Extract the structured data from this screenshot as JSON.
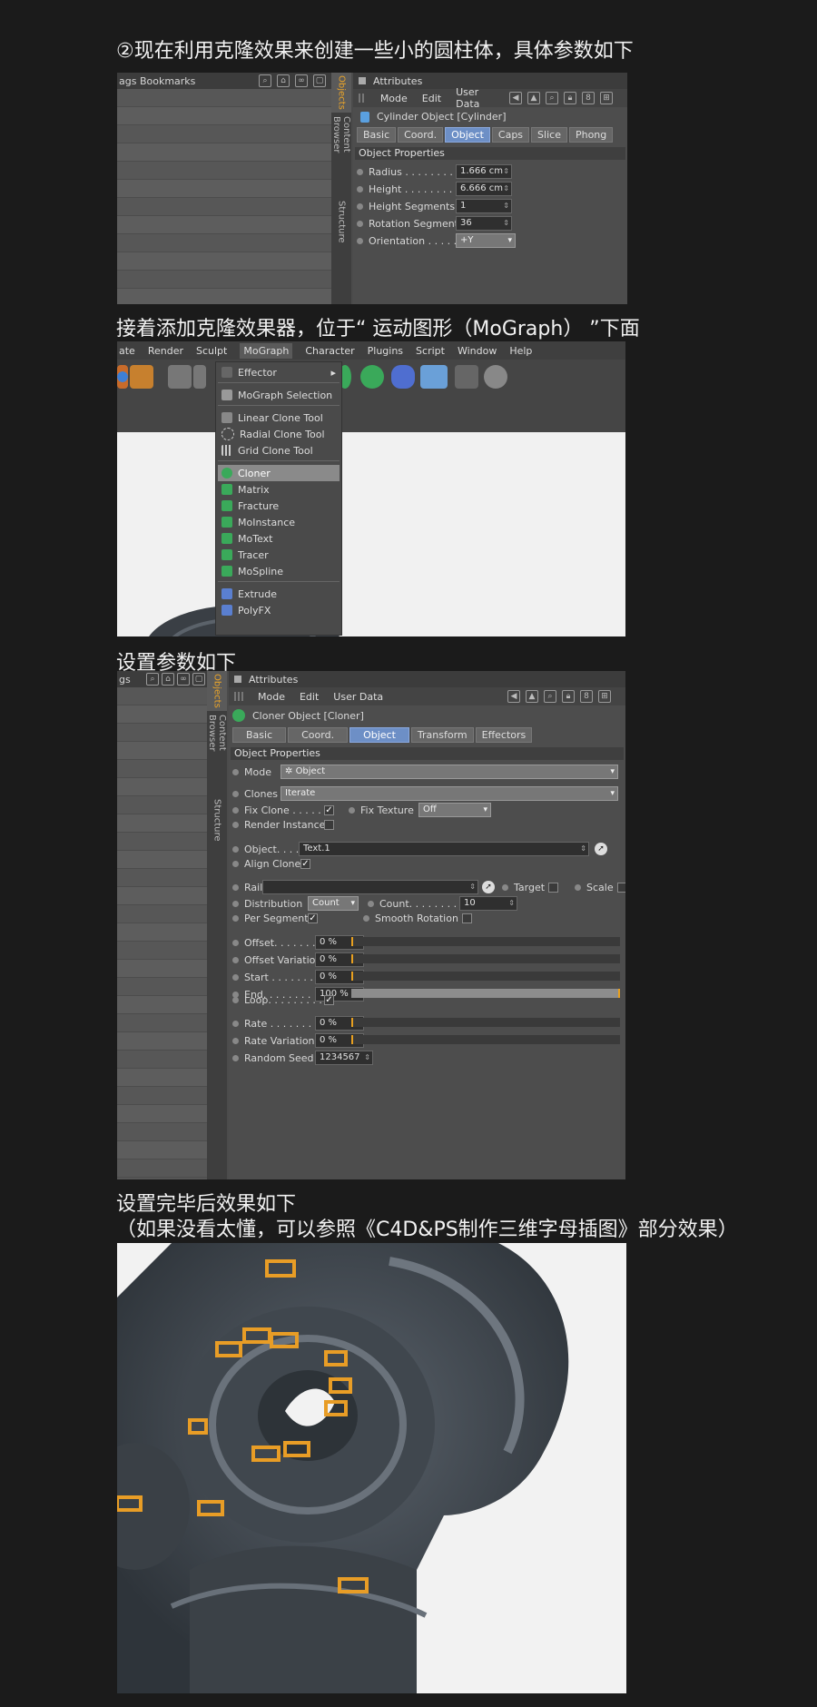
{
  "captions": {
    "c1": "②现在利用克隆效果来创建一些小的圆柱体，具体参数如下",
    "c2": "接着添加克隆效果器，位于“ 运动图形（MoGraph） ”下面",
    "c3": "设置参数如下",
    "c4": "设置完毕后效果如下",
    "c5": "（如果没看太懂，可以参照《C4D&PS制作三维字母插图》部分效果）"
  },
  "panel1": {
    "left_header": "ags   Bookmarks",
    "vtabs": [
      "Objects",
      "Content Browser",
      "Structure"
    ],
    "attr_title": "Attributes",
    "menu": [
      "Mode",
      "Edit",
      "User Data"
    ],
    "object_name": "Cylinder Object [Cylinder]",
    "tabs": [
      "Basic",
      "Coord.",
      "Object",
      "Caps",
      "Slice",
      "Phong"
    ],
    "section": "Object Properties",
    "props": [
      {
        "label": "Radius . . . . . . . . . .",
        "value": "1.666 cm"
      },
      {
        "label": "Height . . . . . . . . . .",
        "value": "6.666 cm"
      },
      {
        "label": "Height Segments",
        "value": "1"
      },
      {
        "label": "Rotation Segments",
        "value": "36"
      },
      {
        "label": "Orientation . . . . . .",
        "value": "+Y"
      }
    ]
  },
  "panel2": {
    "menu": [
      "ate",
      "Render",
      "Sculpt",
      "MoGraph",
      "Character",
      "Plugins",
      "Script",
      "Window",
      "Help"
    ],
    "items": [
      "Effector",
      "MoGraph Selection",
      "Linear Clone Tool",
      "Radial Clone Tool",
      "Grid Clone Tool",
      "Cloner",
      "Matrix",
      "Fracture",
      "MoInstance",
      "MoText",
      "Tracer",
      "MoSpline",
      "Extrude",
      "PolyFX"
    ]
  },
  "panel3": {
    "left_header": "gs",
    "vtabs": [
      "Objects",
      "Content Browser",
      "Structure"
    ],
    "attr_title": "Attributes",
    "menu": [
      "Mode",
      "Edit",
      "User Data"
    ],
    "object_name": "Cloner Object [Cloner]",
    "tabs": [
      "Basic",
      "Coord.",
      "Object",
      "Transform",
      "Effectors"
    ],
    "section": "Object Properties",
    "mode_label": "Mode",
    "mode_value": "Object",
    "clones_label": "Clones",
    "clones_value": "Iterate",
    "fix_clone": "Fix Clone . . . . . .",
    "fix_texture": "Fix Texture",
    "fix_texture_value": "Off",
    "render_instances": "Render Instances",
    "object_label": "Object. . . .",
    "object_value": "Text.1",
    "align_clone": "Align Clone",
    "rail": "Rail",
    "target": "Target",
    "scale": "Scale",
    "distribution": "Distribution",
    "distribution_value": "Count",
    "count_label": "Count. . . . . . . . .",
    "count_value": "10",
    "per_segment": "Per Segment",
    "smooth_rotation": "Smooth Rotation",
    "sliders": [
      {
        "label": "Offset. . . . . . . .",
        "value": "0 %",
        "level": 0
      },
      {
        "label": "Offset Variation",
        "value": "0 %",
        "level": 0
      },
      {
        "label": "Start . . . . . . . . .",
        "value": "0 %",
        "level": 0
      },
      {
        "label": "End. . . . . . . . . .",
        "value": "100 %",
        "level": 100
      }
    ],
    "loop": "Loop. . . . . . . . . .",
    "sliders2": [
      {
        "label": "Rate . . . . . . . . .",
        "value": "0 %",
        "level": 0
      },
      {
        "label": "Rate Variation",
        "value": "0 %",
        "level": 0
      }
    ],
    "random_seed": "Random Seed .",
    "random_seed_value": "1234567"
  }
}
